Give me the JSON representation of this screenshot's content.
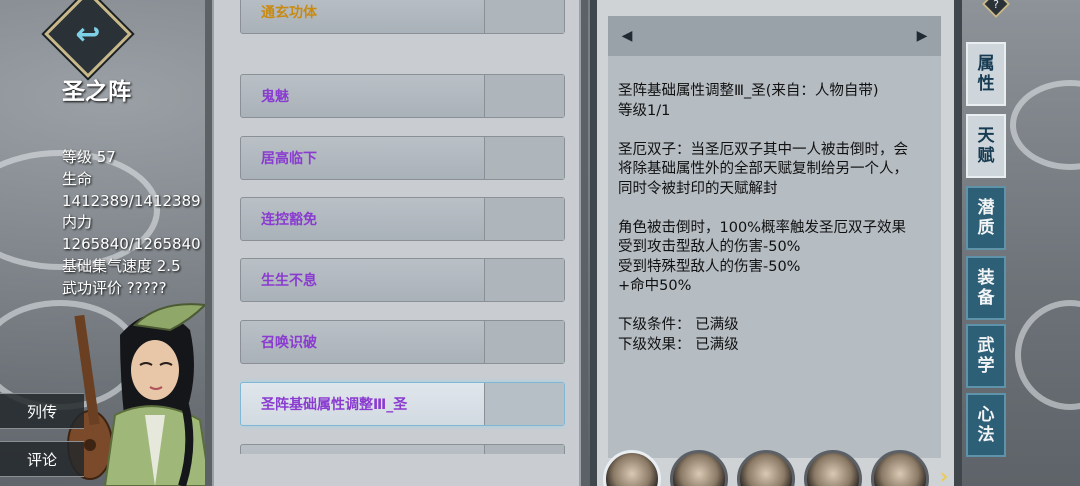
{
  "character": {
    "name": "圣之阵",
    "stats": [
      "等级 57",
      "生命",
      "1412389/1412389",
      "内力",
      "1265840/1265840",
      "基础集气速度 2.5",
      "武功评价 ?????"
    ]
  },
  "side_buttons": [
    "列传",
    "评论"
  ],
  "talents": [
    {
      "label": "通玄功体",
      "color": "#c98a12"
    },
    {
      "label": "鬼魅",
      "color": "#8a3bd0"
    },
    {
      "label": "居高临下",
      "color": "#8a3bd0"
    },
    {
      "label": "连控豁免",
      "color": "#8a3bd0"
    },
    {
      "label": "生生不息",
      "color": "#8a3bd0"
    },
    {
      "label": "召唤识破",
      "color": "#8a3bd0"
    },
    {
      "label": "圣阵基础属性调整Ⅲ_圣",
      "color": "#8a3bd0",
      "selected": true
    }
  ],
  "detail": {
    "lines": [
      "圣阵基础属性调整Ⅲ_圣(来自：人物自带)",
      "等级1/1",
      "",
      "圣厄双子：当圣厄双子其中一人被击倒时，会",
      "将除基础属性外的全部天赋复制给另一个人，",
      "同时令被封印的天赋解封",
      "",
      "角色被击倒时，100%概率触发圣厄双子效果",
      "受到攻击型敌人的伤害-50%",
      "受到特殊型敌人的伤害-50%",
      "+命中50%",
      "",
      "下级条件：  已满级",
      "下级效果：  已满级"
    ]
  },
  "tabs": [
    {
      "label": "属\n性",
      "name": "tab-attributes"
    },
    {
      "label": "天\n赋",
      "name": "tab-talents"
    },
    {
      "label": "潜\n质",
      "name": "tab-potential"
    },
    {
      "label": "装\n备",
      "name": "tab-equipment"
    },
    {
      "label": "武\n学",
      "name": "tab-martial-arts"
    },
    {
      "label": "心\n法",
      "name": "tab-mind-method"
    }
  ],
  "help_label": "?",
  "nav": {
    "prev": "◀",
    "next": "▶"
  },
  "avatar_next": "›",
  "colors": {
    "tab_active": "#cfd6db",
    "tab_inactive": "#2d5f77",
    "selected_border": "#7fb7d4"
  }
}
